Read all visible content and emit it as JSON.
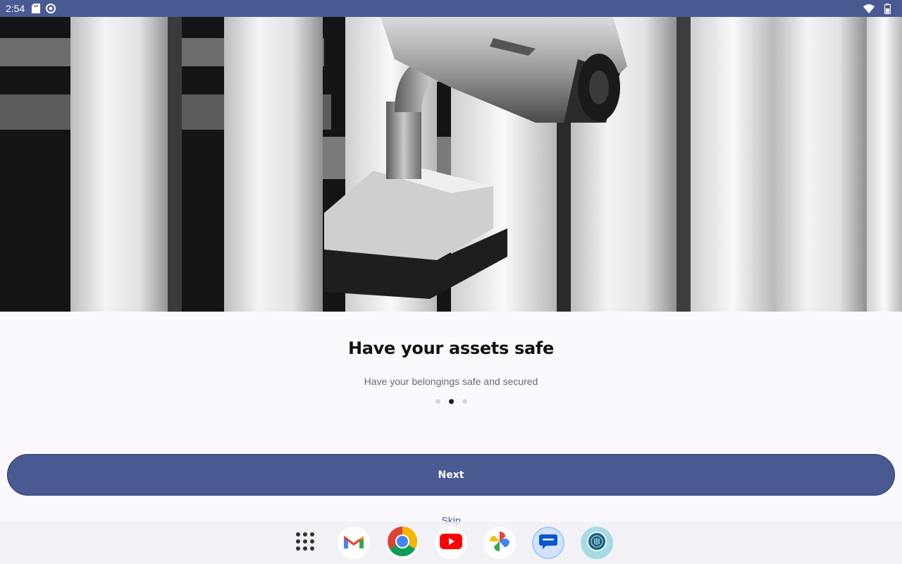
{
  "status_bar": {
    "time": "2:54",
    "left_icons": [
      "sd-card-icon",
      "app-notification-icon"
    ],
    "right_icons": [
      "wifi-icon",
      "battery-icon"
    ],
    "color": "#485a91"
  },
  "hero": {
    "image": "security-camera-photo",
    "description_icon": "cctv-camera"
  },
  "onboarding": {
    "title": "Have your assets safe",
    "subtitle": "Have your belongings safe and secured",
    "page_indicator": {
      "total": 3,
      "current": 2
    },
    "next_label": "Next",
    "skip_label": "Skip"
  },
  "dock": {
    "apps": [
      {
        "name": "app-drawer",
        "icon": "grid-icon"
      },
      {
        "name": "gmail",
        "icon": "gmail-icon"
      },
      {
        "name": "chrome",
        "icon": "chrome-icon"
      },
      {
        "name": "youtube",
        "icon": "youtube-icon"
      },
      {
        "name": "photos",
        "icon": "photos-icon"
      },
      {
        "name": "messages",
        "icon": "messages-icon"
      },
      {
        "name": "app",
        "icon": "app-icon"
      }
    ]
  },
  "colors": {
    "accent": "#485a91",
    "background": "#fbf9fd",
    "title": "#111111",
    "subtitle": "#6a6a72"
  }
}
